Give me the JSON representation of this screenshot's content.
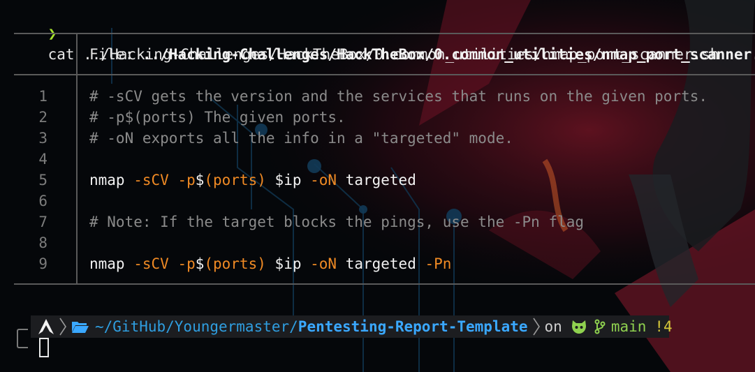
{
  "terminal": {
    "prompt_symbol": "❯",
    "command": "cat ../Hacking-Challenges/HackTheBox/0.common_utilities/nmap_port_scanner.sh"
  },
  "viewer": {
    "file_label": "File: ",
    "file_path": "../Hacking-Challenges/HackTheBox/0.common_utilities/nmap_port_scanner.sh",
    "lines": [
      {
        "no": "1",
        "text": "# -sCV gets the version and the services that runs on the given ports."
      },
      {
        "no": "2",
        "text": "# -p$(ports) The given ports."
      },
      {
        "no": "3",
        "text": "# -oN exports all the info in a \"targeted\" mode."
      },
      {
        "no": "4",
        "text": ""
      },
      {
        "no": "5",
        "tokens": [
          "nmap ",
          "-sCV ",
          "-p",
          "$",
          "(ports) ",
          "$ip ",
          "-oN ",
          "targeted"
        ]
      },
      {
        "no": "6",
        "text": ""
      },
      {
        "no": "7",
        "text": "# Note: If the target blocks the pings, use the -Pn flag"
      },
      {
        "no": "8",
        "text": ""
      },
      {
        "no": "9",
        "tokens": [
          "nmap ",
          "-sCV ",
          "-p",
          "$",
          "(ports) ",
          "$ip ",
          "-oN ",
          "targeted ",
          "-Pn"
        ]
      }
    ]
  },
  "status_bar": {
    "os_icon": "arch-linux-icon",
    "folder_icon": "folder-open-icon",
    "path_prefix": "~/GitHub/Youngermaster/",
    "path_repo": "Pentesting-Report-Template",
    "on_label": "on",
    "git_icon": "github-icon",
    "branch_icon": "git-branch-icon",
    "branch": "main",
    "dirty": "!4"
  },
  "colors": {
    "prompt": "#a6e22e",
    "flag": "#f08a24",
    "comment": "#8b8b8b",
    "path": "#3aa8ff",
    "branch": "#8fd14f"
  }
}
